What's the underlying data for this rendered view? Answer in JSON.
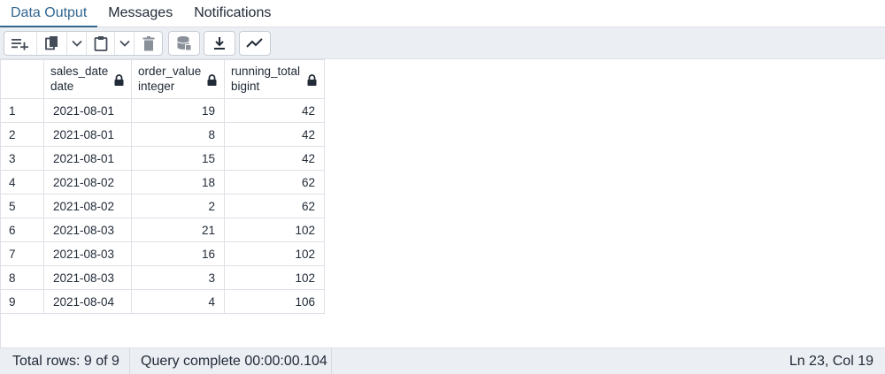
{
  "tabs": [
    {
      "label": "Data Output",
      "active": true
    },
    {
      "label": "Messages",
      "active": false
    },
    {
      "label": "Notifications",
      "active": false
    }
  ],
  "toolbar": {
    "icons": [
      "add-row-icon",
      "copy-icon",
      "chevron-down-icon",
      "paste-icon",
      "chevron-down-icon",
      "delete-icon",
      "save-data-icon",
      "download-icon",
      "graph-icon"
    ]
  },
  "grid": {
    "columns": [
      {
        "name": "sales_date",
        "type": "date"
      },
      {
        "name": "order_value",
        "type": "integer"
      },
      {
        "name": "running_total",
        "type": "bigint"
      }
    ],
    "rows": [
      {
        "num": "1",
        "sales_date": "2021-08-01",
        "order_value": "19",
        "running_total": "42"
      },
      {
        "num": "2",
        "sales_date": "2021-08-01",
        "order_value": "8",
        "running_total": "42"
      },
      {
        "num": "3",
        "sales_date": "2021-08-01",
        "order_value": "15",
        "running_total": "42"
      },
      {
        "num": "4",
        "sales_date": "2021-08-02",
        "order_value": "18",
        "running_total": "62"
      },
      {
        "num": "5",
        "sales_date": "2021-08-02",
        "order_value": "2",
        "running_total": "62"
      },
      {
        "num": "6",
        "sales_date": "2021-08-03",
        "order_value": "21",
        "running_total": "102"
      },
      {
        "num": "7",
        "sales_date": "2021-08-03",
        "order_value": "16",
        "running_total": "102"
      },
      {
        "num": "8",
        "sales_date": "2021-08-03",
        "order_value": "3",
        "running_total": "102"
      },
      {
        "num": "9",
        "sales_date": "2021-08-04",
        "order_value": "4",
        "running_total": "106"
      }
    ]
  },
  "status": {
    "total_rows": "Total rows: 9 of 9",
    "query_status": "Query complete 00:00:00.104",
    "cursor_position": "Ln 23, Col 19"
  },
  "colors": {
    "accent": "#326690",
    "toolbar_bg": "#ebeef3",
    "border": "#dde0e6"
  }
}
